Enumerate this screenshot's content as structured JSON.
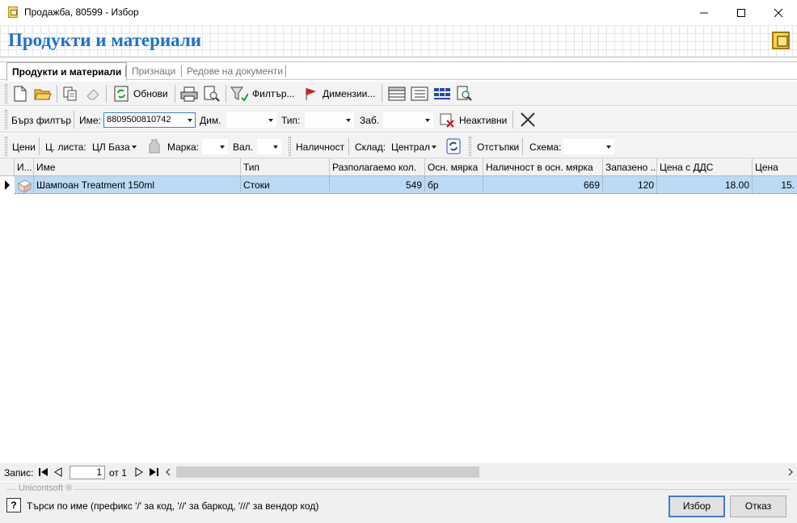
{
  "window": {
    "title": "Продажба, 80599 - Избор",
    "min": "—",
    "max": "☐",
    "close": "✕"
  },
  "header": {
    "title": "Продукти и материали"
  },
  "tabs": [
    {
      "label": "Продукти и материали"
    },
    {
      "label": "Признаци"
    },
    {
      "label": "Редове на документи"
    }
  ],
  "toolbar1": {
    "refresh": "Обнови",
    "filter": "Филтър...",
    "dimensions": "Димензии..."
  },
  "toolbar2": {
    "quick_filter": "Бърз филтър",
    "name_label": "Име:",
    "name_value": "8809500810742",
    "dim_label": "Дим.",
    "type_label": "Тип:",
    "lock_label": "Заб.",
    "inactive_label": "Неактивни"
  },
  "toolbar3": {
    "prices": "Цени",
    "pricelist_label": "Ц. листа:",
    "pricelist_value": "ЦЛ База",
    "brand_label": "Марка:",
    "currency_label": "Вал.",
    "availability": "Наличност",
    "warehouse_label": "Склад:",
    "warehouse_value": "Централ",
    "discounts": "Отстъпки",
    "scheme_label": "Схема:"
  },
  "grid": {
    "columns": [
      "И...",
      "Име",
      "Тип",
      "Разполагаемо кол.",
      "Осн. мярка",
      "Наличност в осн. мярка",
      "Запазено ...",
      "Цена с ДДС",
      "Цена"
    ],
    "rows": [
      {
        "name": "Шампоан Treatment 150ml",
        "type": "Стоки",
        "available": "549",
        "unit": "бр",
        "stock": "669",
        "reserved": "120",
        "price_vat": "18.00",
        "price": "15."
      }
    ]
  },
  "navigator": {
    "label": "Запис:",
    "page": "1",
    "of": "от 1"
  },
  "footer": {
    "brand": "Unicontsoft ®",
    "hint": "Търси по име (префикс '/' за код, '//' за баркод, '///' за вендор код)",
    "ok": "Избор",
    "cancel": "Отказ"
  },
  "colors": {
    "accent": "#1d72c9",
    "selection": "#bcd9f5",
    "primary_border": "#3c7fd1"
  }
}
